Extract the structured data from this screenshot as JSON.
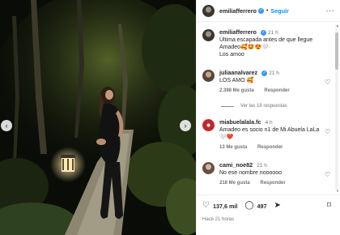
{
  "post": {
    "author": "emiliafferrero",
    "follow_label": "Seguir",
    "more_icon": "more-horizontal-icon",
    "photo_alt": "",
    "posted_ago": "Hace 21 horas"
  },
  "comments": [
    {
      "username": "emiliafferrero",
      "time": "21 h",
      "text": "Última escapada antes de que llegue Amadeo🥰🤩😍🤍",
      "text2": "Los amoo",
      "verified": true
    },
    {
      "username": "juliaanalvarez",
      "time": "21 h",
      "text": "LOS AMO 🥰",
      "likes": "2.398 Me gusta",
      "reply": "Responder",
      "verified": true
    },
    {
      "username": "miabuelalala.fc",
      "time": "4 h",
      "text": "Amadeo es socio n1 de Mi Abuela LaLa🤍❤️",
      "likes": "13 Me gusta",
      "reply": "Responder",
      "verified": false
    },
    {
      "username": "cami_noe82",
      "time": "21 h",
      "text": "No ese nombre noooooo",
      "likes": "218 Me gusta",
      "reply": "Responder",
      "verified": false
    }
  ],
  "view_replies": "Ver las 18 respuestas",
  "actions": {
    "likes_count": "137,6 mil",
    "comments_count": "497",
    "like_icon": "heart-icon",
    "comment_icon": "comment-icon",
    "share_icon": "share-icon",
    "save_icon": "bookmark-icon"
  },
  "colors": {
    "link_blue": "#0095f6",
    "verified_blue": "#3897f0",
    "muted": "#737373",
    "text": "#262626"
  }
}
